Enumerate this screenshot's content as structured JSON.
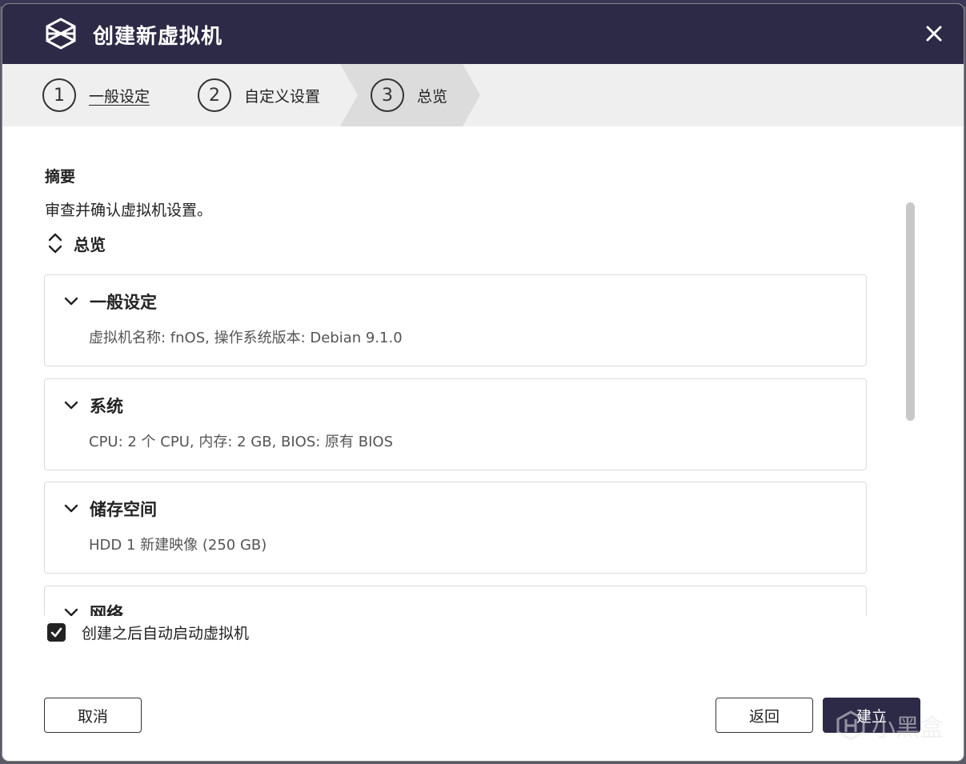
{
  "dialog": {
    "title": "创建新虚拟机",
    "logo_icon": "vm-cube-icon",
    "close_icon": "close-icon"
  },
  "stepper": {
    "steps": [
      {
        "number": "1",
        "label": "一般设定",
        "state": "visited"
      },
      {
        "number": "2",
        "label": "自定义设置",
        "state": "visited"
      },
      {
        "number": "3",
        "label": "总览",
        "state": "active"
      }
    ]
  },
  "summary": {
    "title": "摘要",
    "description": "审查并确认虚拟机设置。",
    "overview_label": "总览",
    "cards": [
      {
        "title": "一般设定",
        "detail": "虚拟机名称: fnOS, 操作系统版本: Debian 9.1.0"
      },
      {
        "title": "系统",
        "detail": "CPU: 2 个 CPU, 内存: 2 GB, BIOS: 原有 BIOS"
      },
      {
        "title": "储存空间",
        "detail": "HDD 1 新建映像 (250 GB)"
      },
      {
        "title": "网络",
        "detail": ""
      }
    ]
  },
  "autostart": {
    "label": "创建之后自动启动虚拟机",
    "checked": true
  },
  "footer": {
    "cancel_label": "取消",
    "back_label": "返回",
    "create_label": "建立"
  },
  "watermark": {
    "text": "小黑盒"
  },
  "colors": {
    "header_bg": "#2d2a47",
    "stepper_bg": "#efefef",
    "active_step_bg": "#dcdcdc",
    "primary_button": "#2d2a47"
  }
}
